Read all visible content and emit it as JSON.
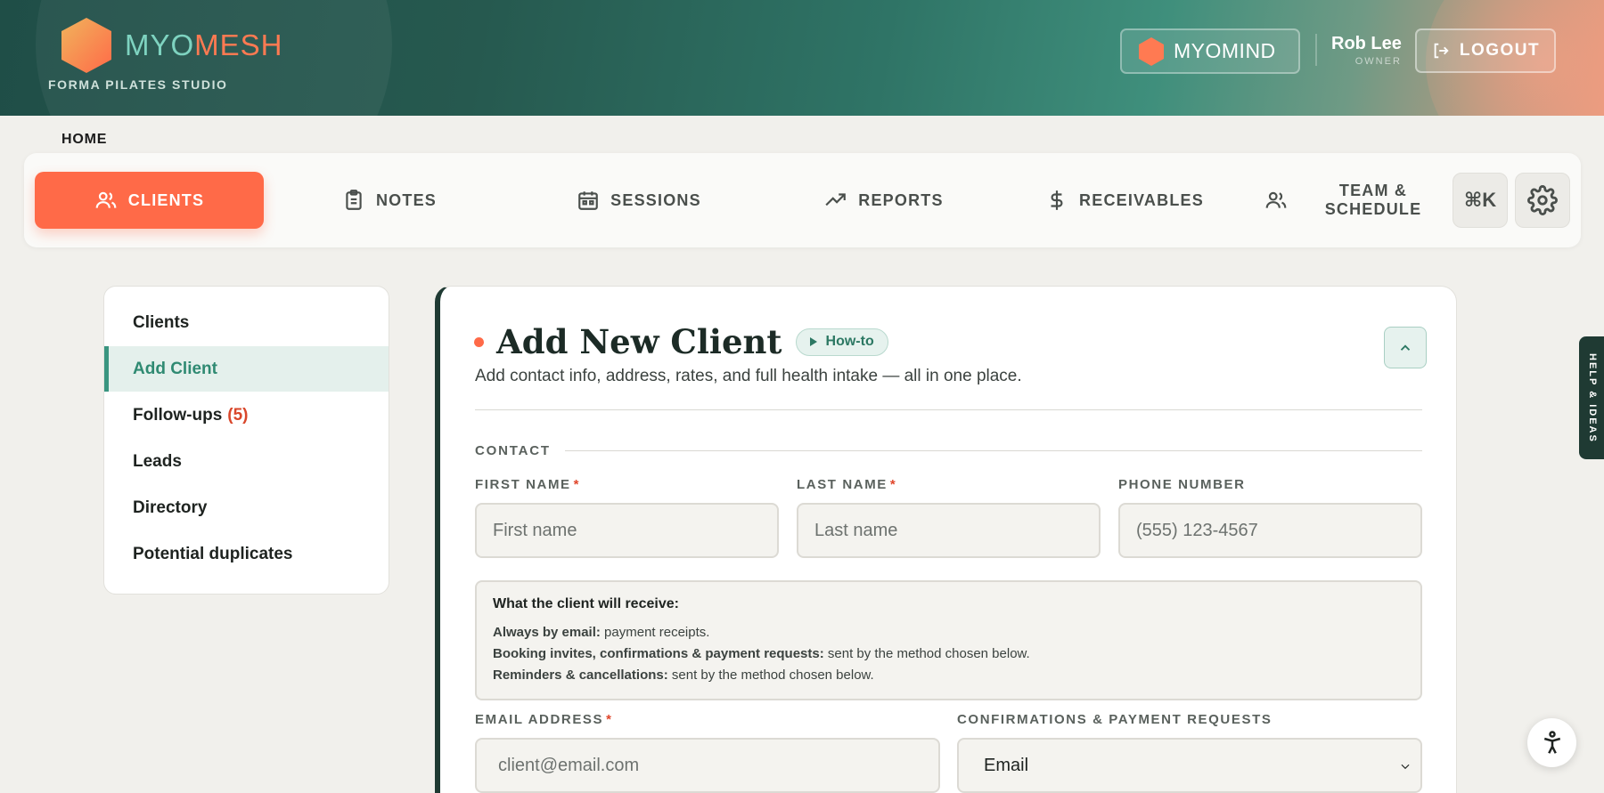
{
  "header": {
    "brand_part1": "MYO",
    "brand_part2": "MESH",
    "studio_name": "FORMA PILATES STUDIO",
    "myomind_label": "MYOMIND",
    "user_name": "Rob Lee",
    "user_role": "OWNER",
    "logout_label": "LOGOUT"
  },
  "breadcrumb": "HOME",
  "nav": {
    "items": [
      {
        "label": "CLIENTS",
        "icon": "users-icon"
      },
      {
        "label": "NOTES",
        "icon": "clipboard-icon"
      },
      {
        "label": "SESSIONS",
        "icon": "calendar-icon"
      },
      {
        "label": "REPORTS",
        "icon": "trending-up-icon"
      },
      {
        "label": "RECEIVABLES",
        "icon": "dollar-icon"
      },
      {
        "label_line1": "TEAM &",
        "label_line2": "SCHEDULE",
        "icon": "team-icon"
      }
    ],
    "command_label": "⌘K",
    "settings_icon": "gear-icon"
  },
  "sidebar": {
    "items": [
      {
        "label": "Clients"
      },
      {
        "label": "Add Client"
      },
      {
        "label": "Follow-ups",
        "count": "(5)"
      },
      {
        "label": "Leads"
      },
      {
        "label": "Directory"
      },
      {
        "label": "Potential duplicates"
      }
    ]
  },
  "form": {
    "title": "Add New Client",
    "howto_label": "How-to",
    "subtitle": "Add contact info, address, rates, and full health intake — all in one place.",
    "section_contact": "CONTACT",
    "first_name_label": "FIRST NAME",
    "first_name_placeholder": "First name",
    "last_name_label": "LAST NAME",
    "last_name_placeholder": "Last name",
    "phone_label": "PHONE NUMBER",
    "phone_placeholder": "(555) 123-4567",
    "required_mark": "*",
    "info": {
      "heading": "What the client will receive:",
      "line1_bold": "Always by email:",
      "line1_text": " payment receipts.",
      "line2_bold": "Booking invites, confirmations & payment requests:",
      "line2_text": " sent by the method chosen below.",
      "line3_bold": "Reminders & cancellations:",
      "line3_text": " sent by the method chosen below."
    },
    "email_label": "EMAIL ADDRESS",
    "email_placeholder": "client@email.com",
    "confirmations_label": "CONFIRMATIONS & PAYMENT REQUESTS",
    "confirmations_value": "Email"
  },
  "help_tab": "HELP & IDEAS",
  "colors": {
    "accent": "#ff6a48",
    "brand_green": "#1f3a33",
    "active_teal": "#2f8a72",
    "alert_red": "#d9472b"
  }
}
